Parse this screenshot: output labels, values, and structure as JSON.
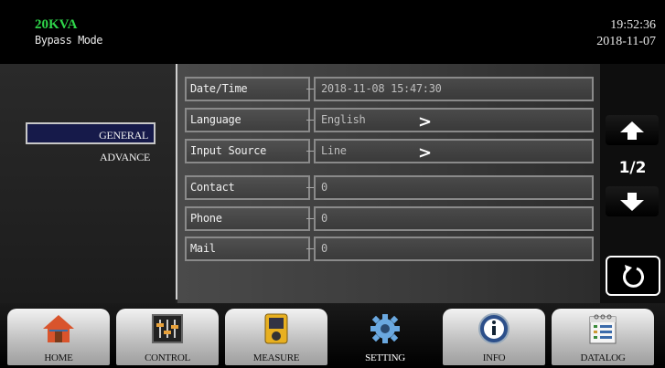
{
  "header": {
    "model": "20KVA",
    "mode": "Bypass Mode",
    "time": "19:52:36",
    "date": "2018-11-07"
  },
  "sidebar": {
    "items": [
      {
        "label": "GENERAL",
        "active": true
      },
      {
        "label": "ADVANCE",
        "active": false
      }
    ]
  },
  "settings": {
    "rows": [
      {
        "label": "Date/Time",
        "value": "2018-11-08 15:47:30"
      },
      {
        "label": "Language",
        "value": "English"
      },
      {
        "label": "Input Source",
        "value": "Line"
      },
      {
        "label": "Contact",
        "value": "0"
      },
      {
        "label": "Phone",
        "value": "0"
      },
      {
        "label": "Mail",
        "value": "0"
      }
    ]
  },
  "pagination": {
    "page": "1/2"
  },
  "footer": {
    "tabs": [
      {
        "label": "HOME",
        "icon": "home-icon"
      },
      {
        "label": "CONTROL",
        "icon": "sliders-icon"
      },
      {
        "label": "MEASURE",
        "icon": "meter-icon"
      },
      {
        "label": "SETTING",
        "icon": "gear-icon"
      },
      {
        "label": "INFO",
        "icon": "info-icon"
      },
      {
        "label": "DATALOG",
        "icon": "calendar-icon"
      }
    ]
  },
  "colors": {
    "model_text": "#2fd64a",
    "active_nav_bg": "#161a4a"
  }
}
